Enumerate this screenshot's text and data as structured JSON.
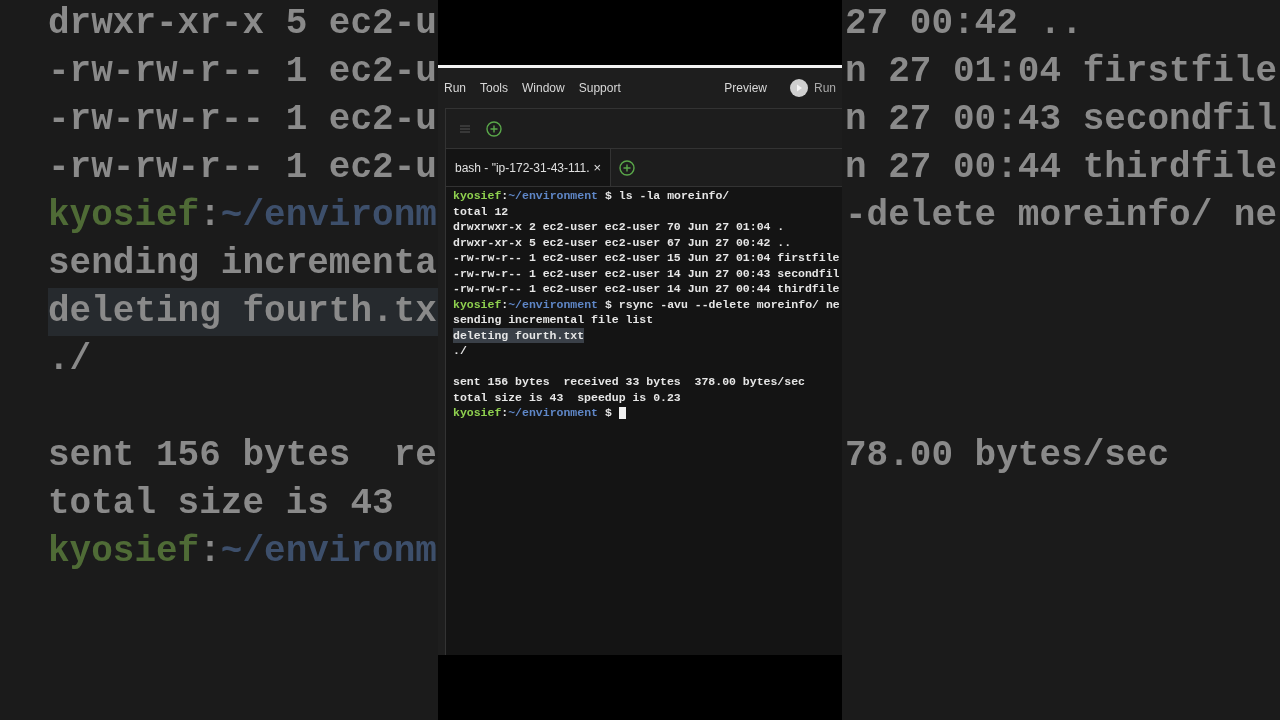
{
  "menu": {
    "items": [
      "Run",
      "Tools",
      "Window",
      "Support"
    ],
    "preview": "Preview",
    "run_button": "Run"
  },
  "terminal_tabs": [
    {
      "label": "bash - \"ip-172-31-43-111.",
      "close": "×",
      "selected": true
    }
  ],
  "terminal": {
    "lines": [
      {
        "kind": "prompt",
        "user": "kyosief",
        "sep": ":",
        "path": "~/environment",
        "symbol": "$",
        "command": "ls -la moreinfo/"
      },
      {
        "kind": "output",
        "text": "total 12",
        "highlighted": false
      },
      {
        "kind": "output",
        "text": "drwxrwxr-x 2 ec2-user ec2-user 70 Jun 27 01:04 .",
        "highlighted": false
      },
      {
        "kind": "output",
        "text": "drwxr-xr-x 5 ec2-user ec2-user 67 Jun 27 00:42 ..",
        "highlighted": false
      },
      {
        "kind": "output",
        "text": "-rw-rw-r-- 1 ec2-user ec2-user 15 Jun 27 01:04 firstfile",
        "highlighted": false
      },
      {
        "kind": "output",
        "text": "-rw-rw-r-- 1 ec2-user ec2-user 14 Jun 27 00:43 secondfil",
        "highlighted": false
      },
      {
        "kind": "output",
        "text": "-rw-rw-r-- 1 ec2-user ec2-user 14 Jun 27 00:44 thirdfile",
        "highlighted": false
      },
      {
        "kind": "prompt",
        "user": "kyosief",
        "sep": ":",
        "path": "~/environment",
        "symbol": "$",
        "command": "rsync -avu --delete moreinfo/ ne"
      },
      {
        "kind": "output",
        "text": "sending incremental file list",
        "highlighted": false
      },
      {
        "kind": "output",
        "text": "deleting fourth.txt",
        "highlighted": true
      },
      {
        "kind": "output",
        "text": "./",
        "highlighted": false
      },
      {
        "kind": "blank"
      },
      {
        "kind": "output",
        "text": "sent 156 bytes  received 33 bytes  378.00 bytes/sec",
        "highlighted": false
      },
      {
        "kind": "output",
        "text": "total size is 43  speedup is 0.23",
        "highlighted": false
      },
      {
        "kind": "prompt",
        "user": "kyosief",
        "sep": ":",
        "path": "~/environment",
        "symbol": "$",
        "cursor": true
      }
    ]
  },
  "background": {
    "left_lines": [
      {
        "kind": "output",
        "text": "drwxr-xr-x 5 ec2-u",
        "highlighted": false
      },
      {
        "kind": "output",
        "text": "-rw-rw-r-- 1 ec2-u",
        "highlighted": false
      },
      {
        "kind": "output",
        "text": "-rw-rw-r-- 1 ec2-u",
        "highlighted": false
      },
      {
        "kind": "output",
        "text": "-rw-rw-r-- 1 ec2-u",
        "highlighted": false
      },
      {
        "kind": "prompt",
        "user": "kyosief",
        "sep": ":",
        "path": "~/environm"
      },
      {
        "kind": "output",
        "text": "sending incrementa",
        "highlighted": false
      },
      {
        "kind": "output",
        "text": "deleting fourth.tx",
        "highlighted": true
      },
      {
        "kind": "output",
        "text": "./",
        "highlighted": false
      },
      {
        "kind": "blank"
      },
      {
        "kind": "output",
        "text": "sent 156 bytes  re",
        "highlighted": false
      },
      {
        "kind": "output",
        "text": "total size is 43",
        "highlighted": false
      },
      {
        "kind": "prompt",
        "user": "kyosief",
        "sep": ":",
        "path": "~/environm"
      }
    ],
    "right_lines": [
      {
        "kind": "output",
        "text": "27 00:42 ..",
        "highlighted": false
      },
      {
        "kind": "output",
        "text": "n 27 01:04 firstfile",
        "highlighted": false
      },
      {
        "kind": "output",
        "text": "n 27 00:43 secondfil",
        "highlighted": false
      },
      {
        "kind": "output",
        "text": "n 27 00:44 thirdfile",
        "highlighted": false
      },
      {
        "kind": "output",
        "text": "-delete moreinfo/ ne",
        "highlighted": false
      },
      {
        "kind": "blank"
      },
      {
        "kind": "blank"
      },
      {
        "kind": "blank"
      },
      {
        "kind": "blank"
      },
      {
        "kind": "output",
        "text": "78.00 bytes/sec",
        "highlighted": false
      }
    ]
  }
}
